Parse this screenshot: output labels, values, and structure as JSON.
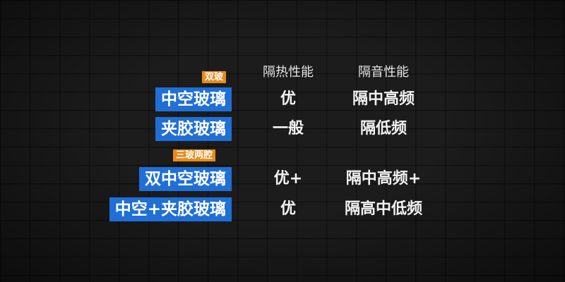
{
  "headers": {
    "heat": "隔热性能",
    "sound": "隔音性能"
  },
  "groups": [
    {
      "tag": "双玻",
      "rows": [
        {
          "name": "中空玻璃",
          "heat": "优",
          "sound": "隔中高频"
        },
        {
          "name": "夹胶玻璃",
          "heat": "一般",
          "sound": "隔低频"
        }
      ]
    },
    {
      "tag": "三玻两腔",
      "rows": [
        {
          "name": "双中空玻璃",
          "heat": "优+",
          "sound": "隔中高频+"
        },
        {
          "name": "中空+夹胶玻璃",
          "heat": "优",
          "sound": "隔高中低频"
        }
      ]
    }
  ],
  "colors": {
    "tag": "#e98a1a",
    "label_bg": "#1f6fd6",
    "background": "#1c1c1c"
  }
}
